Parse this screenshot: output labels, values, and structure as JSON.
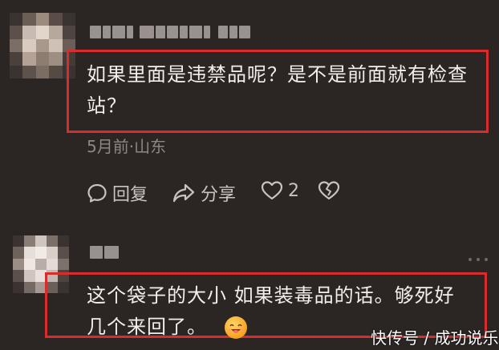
{
  "comments": [
    {
      "username": "",
      "text_line1": "如果里面是违禁品呢？是不是前面就有检查",
      "text_line2": "站？",
      "meta": "5月前·山东",
      "reply_label": "回复",
      "share_label": "分享",
      "like_count": "2"
    },
    {
      "username": "",
      "text_line1": "这个袋子的大小  如果装毒品的话。够死好",
      "text_line2": "几个来回了。"
    }
  ],
  "watermark": "快传号 / 成功说乐",
  "colors": {
    "background": "#2b2624",
    "highlight_border": "#d92d2d",
    "meta_text": "#8e8784"
  },
  "icons": [
    "reply-icon",
    "share-icon",
    "like-icon",
    "dislike-icon",
    "more-icon",
    "emoji-icon"
  ]
}
